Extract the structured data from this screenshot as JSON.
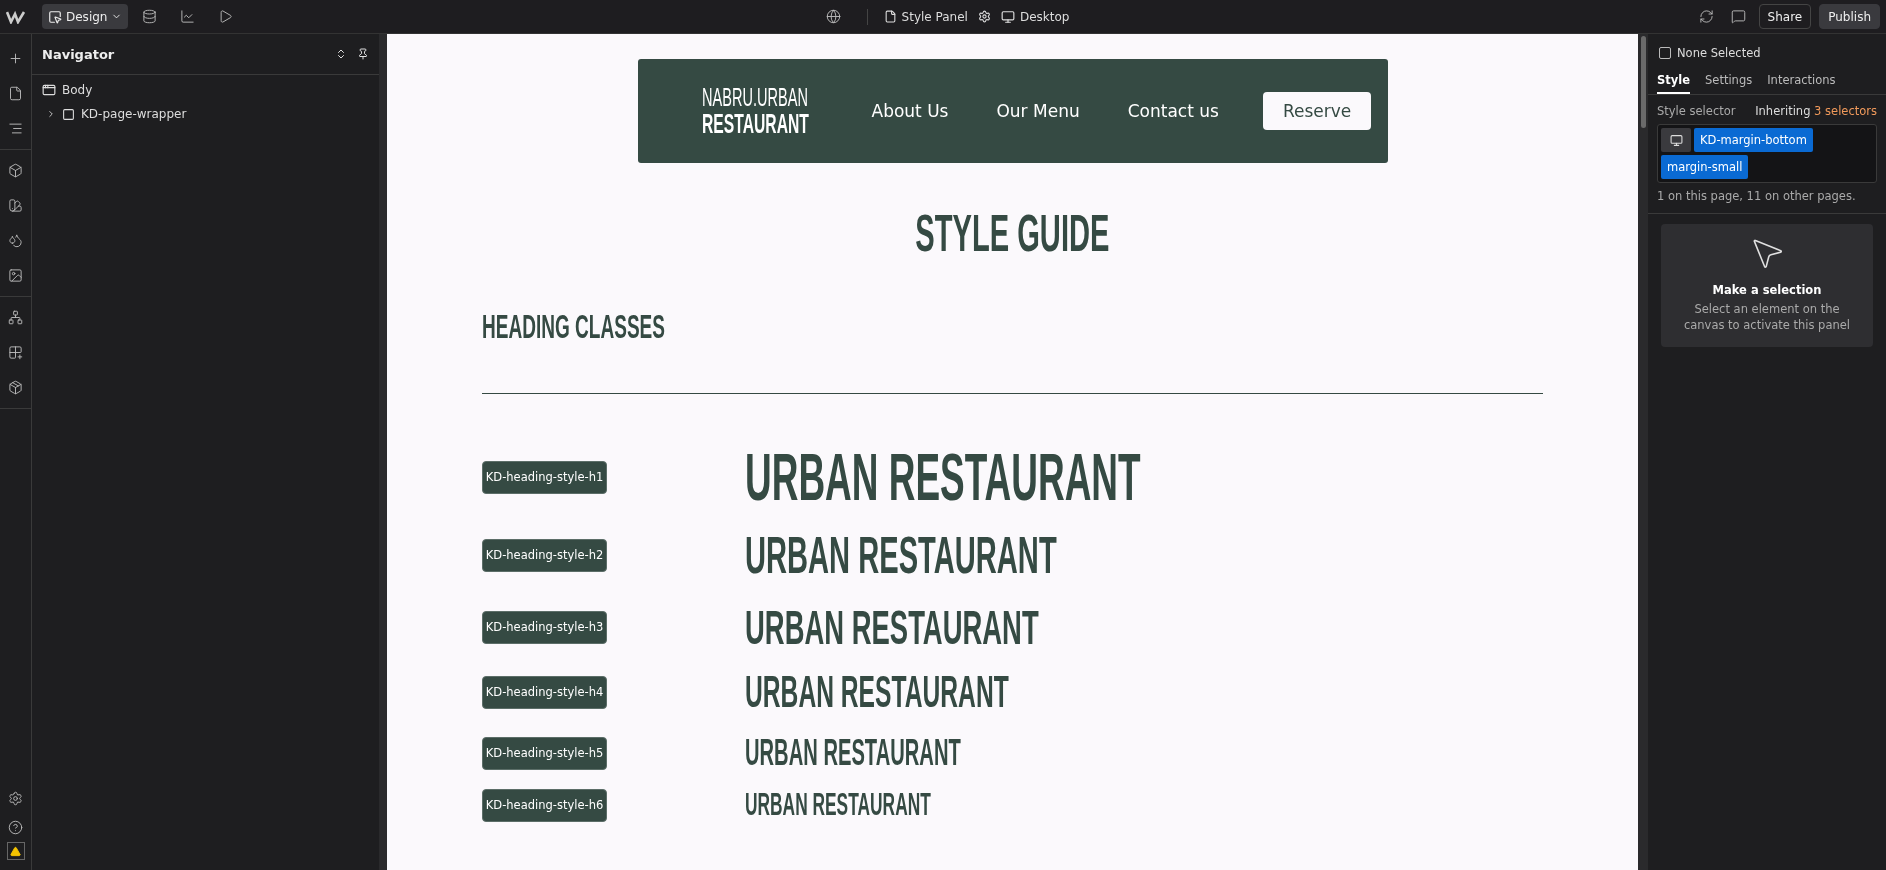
{
  "topbar": {
    "mode": "Design",
    "page": "Style Panel",
    "breakpoint": "Desktop",
    "buttons": [
      {
        "label": "Share",
        "kind": "secondary"
      },
      {
        "label": "Publish",
        "kind": "primary"
      }
    ]
  },
  "navigator": {
    "title": "Navigator",
    "tree": [
      {
        "label": "Body",
        "kind": "body",
        "children": [
          {
            "label": "KD-page-wrapper",
            "kind": "block",
            "expanded": false
          }
        ]
      }
    ]
  },
  "canvas": {
    "nav": {
      "logo_top": "NABRU.URBAN",
      "logo_bottom": "RESTAURANT",
      "links": [
        "About Us",
        "Our Menu",
        "Contact us"
      ],
      "cta": "Reserve"
    },
    "title": "STYLE GUIDE",
    "section_heading": "HEADING CLASSES",
    "rows": [
      {
        "class": "KD-heading-style-h1",
        "sample": "URBAN RESTAURANT",
        "kind": "h1"
      },
      {
        "class": "KD-heading-style-h2",
        "sample": "URBAN RESTAURANT",
        "kind": "h2"
      },
      {
        "class": "KD-heading-style-h3",
        "sample": "URBAN RESTAURANT",
        "kind": "h3"
      },
      {
        "class": "KD-heading-style-h4",
        "sample": "URBAN RESTAURANT",
        "kind": "h4"
      },
      {
        "class": "KD-heading-style-h5",
        "sample": "URBAN RESTAURANT",
        "kind": "h5"
      },
      {
        "class": "KD-heading-style-h6",
        "sample": "URBAN RESTAURANT",
        "kind": "h6"
      }
    ]
  },
  "panel": {
    "selection": {
      "label": "None Selected",
      "checked": false
    },
    "tabs": [
      {
        "label": "Style",
        "selected": true
      },
      {
        "label": "Settings",
        "selected": false
      },
      {
        "label": "Interactions",
        "selected": false
      }
    ],
    "selector_label": "Style selector",
    "inheriting": "Inheriting",
    "inheriting_count": "3 selectors",
    "tags": [
      "KD-margin-bottom",
      "margin-small"
    ],
    "usage": "1 on this page, 11 on other pages.",
    "empty": {
      "title": "Make a selection",
      "text": "Select an element on the canvas to activate this panel"
    }
  }
}
